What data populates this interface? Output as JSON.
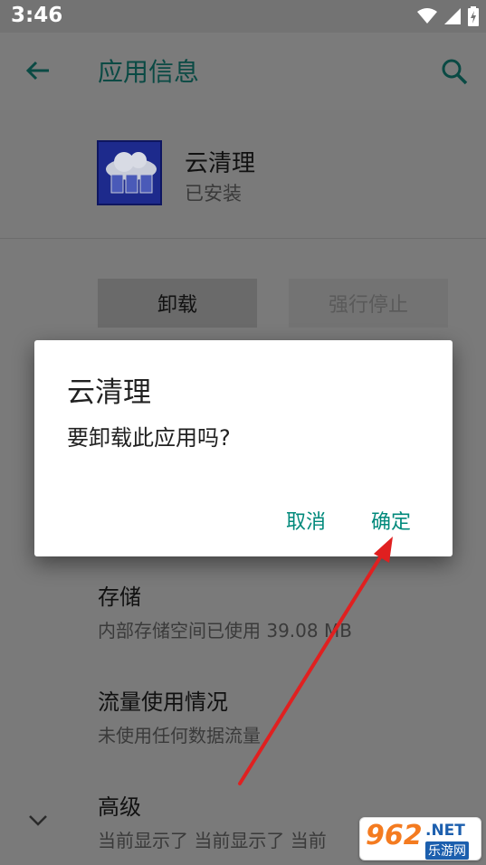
{
  "status_bar": {
    "time": "3:46"
  },
  "app_bar": {
    "title": "应用信息"
  },
  "app": {
    "name": "云清理",
    "status": "已安装"
  },
  "buttons": {
    "uninstall": "卸载",
    "force_stop": "强行停止"
  },
  "storage": {
    "title": "存储",
    "subtitle": "内部存储空间已使用 39.08 MB"
  },
  "data_usage": {
    "title": "流量使用情况",
    "subtitle": "未使用任何数据流量"
  },
  "advanced": {
    "title": "高级",
    "subtitle": "当前显示了 当前显示了 当前"
  },
  "dialog": {
    "title": "云清理",
    "message": "要卸载此应用吗?",
    "cancel": "取消",
    "ok": "确定"
  },
  "watermark": {
    "number": "962",
    "net": ".NET",
    "site": "乐游网"
  },
  "colors": {
    "accent": "#00897b",
    "annotation_arrow": "#e02020"
  }
}
